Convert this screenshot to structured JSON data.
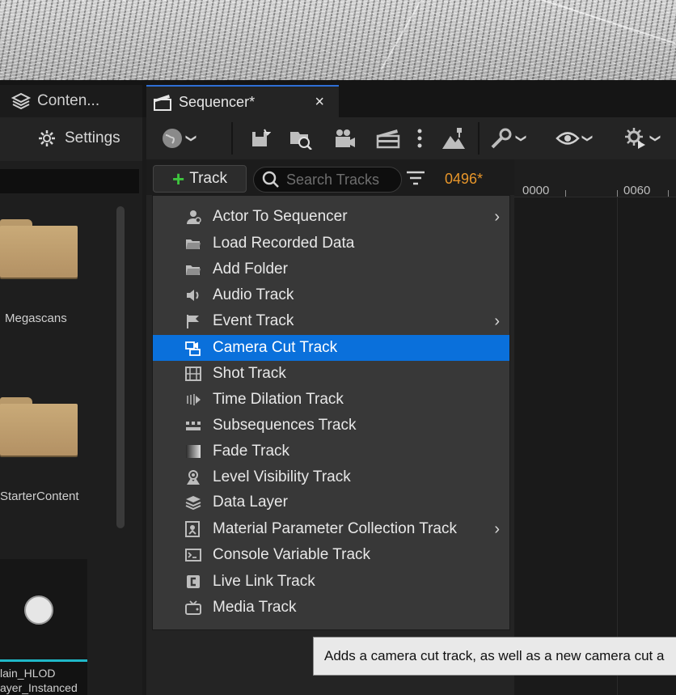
{
  "tabs": [
    {
      "label": "Conten...",
      "icon": "layers-icon"
    },
    {
      "label": "Sequencer*",
      "icon": "clapperboard-icon",
      "close": "×"
    }
  ],
  "content_browser": {
    "settings_label": "Settings",
    "folders": [
      {
        "label": "Megascans"
      },
      {
        "label": "StarterContent"
      }
    ],
    "asset": {
      "label_line1": "lain_HLOD",
      "label_line2": "ayer_Instanced"
    }
  },
  "sequencer": {
    "track_button": "Track",
    "search_placeholder": "Search Tracks",
    "current_frame": "0496*",
    "ruler_labels": [
      "0000",
      "0060"
    ],
    "toolbar_icons": [
      "world-icon",
      "save-icon",
      "find-icon",
      "camera-icon",
      "clapper-icon",
      "more-icon",
      "actor-icon",
      "wrench-icon",
      "eye-icon",
      "gear-play-icon"
    ]
  },
  "menu": {
    "items": [
      {
        "label": "Actor To Sequencer",
        "icon": "actor-icon",
        "submenu": true,
        "selected": false
      },
      {
        "label": "Load Recorded Data",
        "icon": "folder-open-icon",
        "submenu": false,
        "selected": false
      },
      {
        "label": "Add Folder",
        "icon": "folder-open-icon",
        "submenu": false,
        "selected": false
      },
      {
        "label": "Audio Track",
        "icon": "speaker-icon",
        "submenu": false,
        "selected": false
      },
      {
        "label": "Event Track",
        "icon": "flag-icon",
        "submenu": true,
        "selected": false
      },
      {
        "label": "Camera Cut Track",
        "icon": "camera-cut-icon",
        "submenu": false,
        "selected": true
      },
      {
        "label": "Shot Track",
        "icon": "film-strip-icon",
        "submenu": false,
        "selected": false
      },
      {
        "label": "Time Dilation Track",
        "icon": "time-dilation-icon",
        "submenu": false,
        "selected": false
      },
      {
        "label": "Subsequences Track",
        "icon": "subsequence-icon",
        "submenu": false,
        "selected": false
      },
      {
        "label": "Fade Track",
        "icon": "fade-icon",
        "submenu": false,
        "selected": false
      },
      {
        "label": "Level Visibility Track",
        "icon": "level-visibility-icon",
        "submenu": false,
        "selected": false
      },
      {
        "label": "Data Layer",
        "icon": "layers-icon",
        "submenu": false,
        "selected": false
      },
      {
        "label": "Material Parameter Collection Track",
        "icon": "material-icon",
        "submenu": true,
        "selected": false
      },
      {
        "label": "Console Variable Track",
        "icon": "console-icon",
        "submenu": false,
        "selected": false
      },
      {
        "label": "Live Link Track",
        "icon": "live-link-icon",
        "submenu": false,
        "selected": false
      },
      {
        "label": "Media Track",
        "icon": "tv-icon",
        "submenu": false,
        "selected": false
      }
    ],
    "submenu_glyph": "›"
  },
  "tooltip": {
    "text": "Adds a camera cut track, as well as a new camera cut a"
  },
  "colors": {
    "accent": "#0a70db",
    "frame_number": "#e8962a",
    "plus": "#3ec43e",
    "tab_highlight": "#2f6fd6"
  }
}
